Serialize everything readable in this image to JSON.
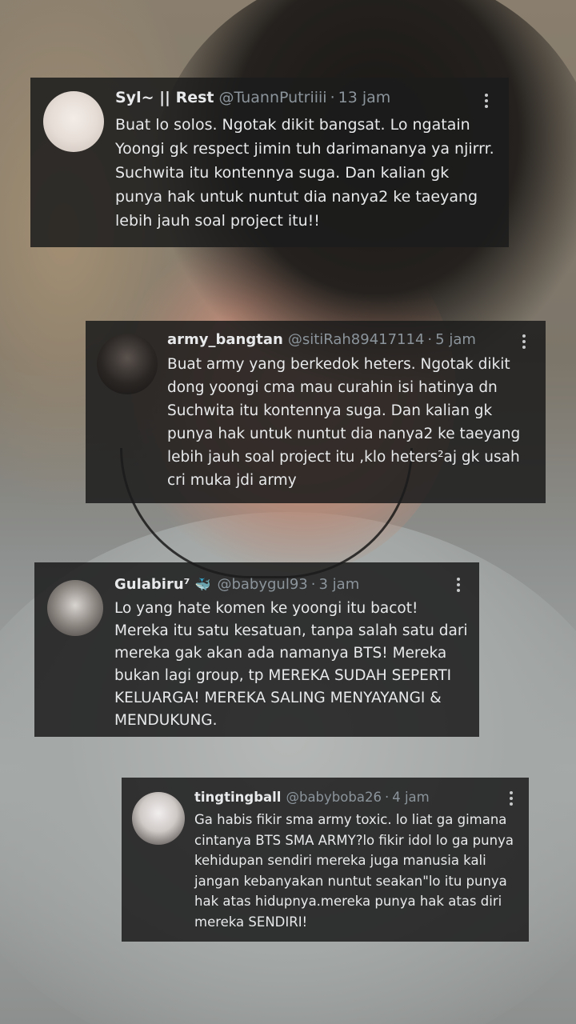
{
  "tweets": [
    {
      "name": "Syl~ || Rest",
      "handle": "@TuannPutriiii",
      "time": "13 jam",
      "text": "Buat lo solos. Ngotak dikit bangsat. Lo ngatain Yoongi gk respect jimin tuh darimananya ya njirrr. Suchwita itu kontennya suga. Dan kalian gk punya hak untuk nuntut dia nanya2 ke taeyang lebih jauh soal project itu!!"
    },
    {
      "name": "army_bangtan",
      "handle": "@sitiRah89417114",
      "time": "5 jam",
      "text": "Buat army yang berkedok heters. Ngotak dikit dong yoongi cma mau curahin isi hatinya dn Suchwita itu kontennya suga. Dan kalian gk punya hak untuk nuntut dia nanya2 ke taeyang lebih jauh soal project itu ,klo heters²aj gk usah cri muka jdi army"
    },
    {
      "name": "Gulabiru⁷",
      "name_emoji": "🐳",
      "handle": "@babygul93",
      "time": "3 jam",
      "text": "Lo yang hate komen ke yoongi itu bacot! Mereka itu satu kesatuan, tanpa salah satu dari mereka gak akan ada namanya BTS! Mereka bukan lagi group, tp MEREKA SUDAH SEPERTI KELUARGA! MEREKA SALING MENYAYANGI & MENDUKUNG."
    },
    {
      "name": "tingtingball",
      "handle": "@babyboba26",
      "time": "4 jam",
      "text": "Ga habis fikir sma army toxic. lo liat ga gimana cintanya BTS SMA ARMY?lo fikir idol lo ga punya kehidupan sendiri mereka juga manusia kali jangan kebanyakan nuntut seakan\"lo itu punya hak atas hidupnya.mereka punya hak atas diri mereka SENDIRI!"
    }
  ],
  "separator": "·",
  "icons": {
    "avatar": "avatar",
    "more": "more-vertical-icon"
  }
}
